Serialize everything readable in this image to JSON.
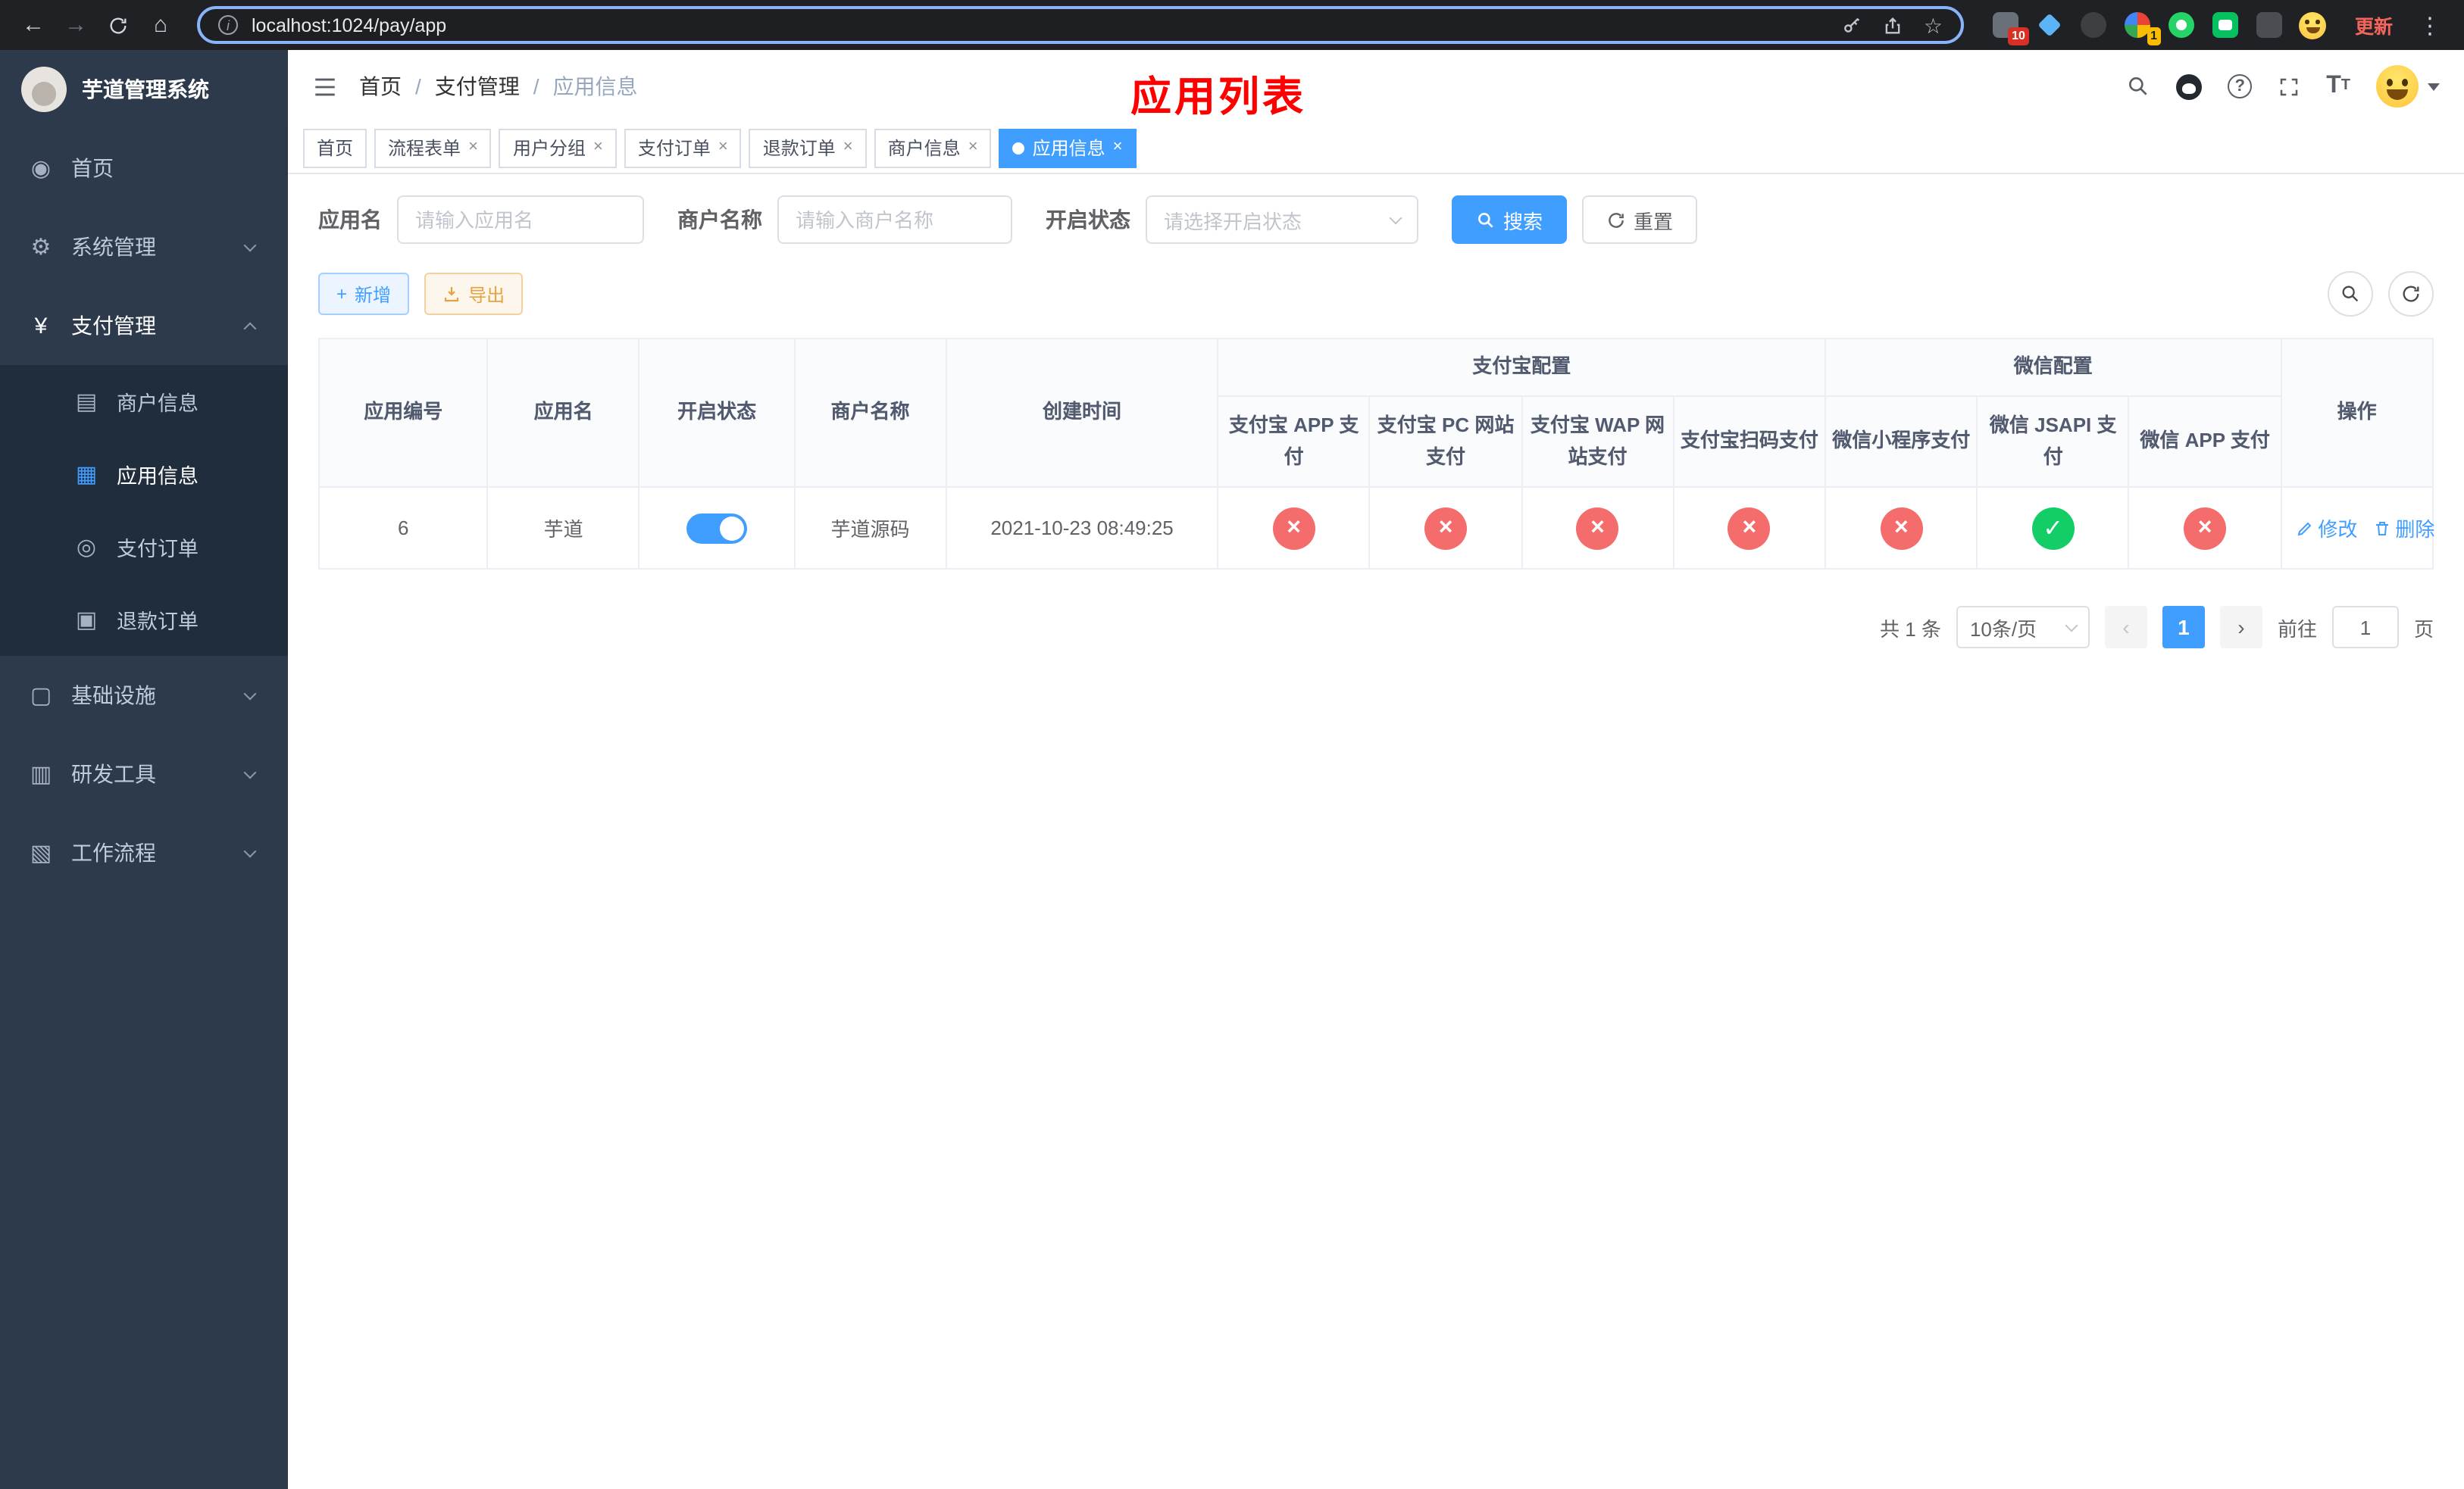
{
  "browser": {
    "url": "localhost:1024/pay/app",
    "update_label": "更新",
    "extension_badge_count": "10",
    "extension_badge_alt": "1"
  },
  "sidebar": {
    "title": "芋道管理系统",
    "items": [
      {
        "label": "首页",
        "icon": "dashboard-icon"
      },
      {
        "label": "系统管理",
        "icon": "gear-icon"
      },
      {
        "label": "支付管理",
        "icon": "yen-icon"
      },
      {
        "label": "商户信息",
        "icon": "merchant-card-icon"
      },
      {
        "label": "应用信息",
        "icon": "app-grid-icon"
      },
      {
        "label": "支付订单",
        "icon": "pay-order-icon"
      },
      {
        "label": "退款订单",
        "icon": "refund-order-icon"
      },
      {
        "label": "基础设施",
        "icon": "infrastructure-icon"
      },
      {
        "label": "研发工具",
        "icon": "devtools-icon"
      },
      {
        "label": "工作流程",
        "icon": "workflow-icon"
      }
    ]
  },
  "header": {
    "breadcrumb": [
      "首页",
      "支付管理",
      "应用信息"
    ],
    "annotation": "应用列表"
  },
  "tabs": [
    {
      "label": "首页"
    },
    {
      "label": "流程表单"
    },
    {
      "label": "用户分组"
    },
    {
      "label": "支付订单"
    },
    {
      "label": "退款订单"
    },
    {
      "label": "商户信息"
    },
    {
      "label": "应用信息"
    }
  ],
  "filters": {
    "app_name_label": "应用名",
    "app_name_placeholder": "请输入应用名",
    "merchant_label": "商户名称",
    "merchant_placeholder": "请输入商户名称",
    "status_label": "开启状态",
    "status_placeholder": "请选择开启状态",
    "search_label": "搜索",
    "reset_label": "重置"
  },
  "toolbar": {
    "add_label": "新增",
    "export_label": "导出"
  },
  "table": {
    "group_headers": {
      "alipay": "支付宝配置",
      "wechat": "微信配置"
    },
    "columns": [
      "应用编号",
      "应用名",
      "开启状态",
      "商户名称",
      "创建时间",
      "支付宝 APP 支付",
      "支付宝 PC 网站支付",
      "支付宝 WAP 网站支付",
      "支付宝扫码支付",
      "微信小程序支付",
      "微信 JSAPI 支付",
      "微信 APP 支付",
      "操作"
    ],
    "rows": [
      {
        "id": "6",
        "name": "芋道",
        "enabled": true,
        "merchant": "芋道源码",
        "created": "2021-10-23 08:49:25",
        "channels": [
          "no",
          "no",
          "no",
          "no",
          "no",
          "yes",
          "no"
        ],
        "edit_label": "修改",
        "delete_label": "删除"
      }
    ]
  },
  "pagination": {
    "total_text": "共 1 条",
    "page_size": "10条/页",
    "current_page": "1",
    "goto_label": "前往",
    "goto_value": "1",
    "page_suffix": "页"
  },
  "colors": {
    "accent": "#409eff",
    "danger": "#f56c6c",
    "success": "#13ce66",
    "warning": "#e6a23c",
    "annotation_red": "#ff0000",
    "sidebar_bg": "#2d3a4b",
    "submenu_bg": "#1f2d3d"
  }
}
